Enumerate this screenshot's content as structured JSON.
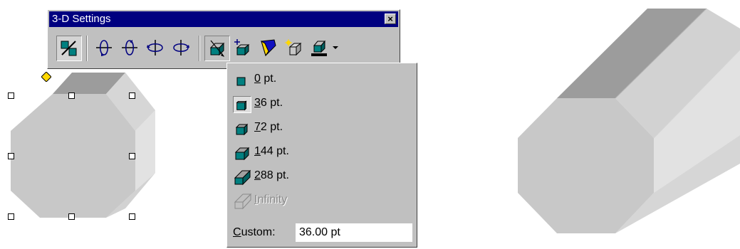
{
  "toolbar": {
    "title": "3-D Settings",
    "close_glyph": "×",
    "buttons": [
      {
        "name": "3d-on-off-icon",
        "state": "pressed"
      },
      {
        "name": "tilt-down-icon"
      },
      {
        "name": "tilt-up-icon"
      },
      {
        "name": "tilt-left-icon"
      },
      {
        "name": "tilt-right-icon"
      },
      {
        "name": "depth-icon",
        "state": "open"
      },
      {
        "name": "direction-icon"
      },
      {
        "name": "lighting-icon"
      },
      {
        "name": "surface-icon"
      },
      {
        "name": "3d-color-icon"
      }
    ]
  },
  "depth_menu": {
    "items": [
      {
        "accel": "0",
        "rest": " pt.",
        "selected": false,
        "enabled": true
      },
      {
        "accel": "3",
        "rest": "6 pt.",
        "selected": true,
        "enabled": true
      },
      {
        "accel": "7",
        "rest": "2 pt.",
        "selected": false,
        "enabled": true
      },
      {
        "accel": "1",
        "rest": "44 pt.",
        "selected": false,
        "enabled": true
      },
      {
        "accel": "2",
        "rest": "88 pt.",
        "selected": false,
        "enabled": true
      },
      {
        "accel": "I",
        "rest": "nfinity",
        "selected": false,
        "enabled": false
      }
    ],
    "custom_label_accel": "C",
    "custom_label_rest": "ustom:",
    "custom_value": "36.00 pt"
  },
  "colors": {
    "titlebar": "#000080",
    "face": "#c0c0c0",
    "shape_front": "#c8c8c8",
    "shape_top": "#9c9c9c",
    "shape_side": "#e0e0e0",
    "depth_icon_fill": "#008080"
  }
}
